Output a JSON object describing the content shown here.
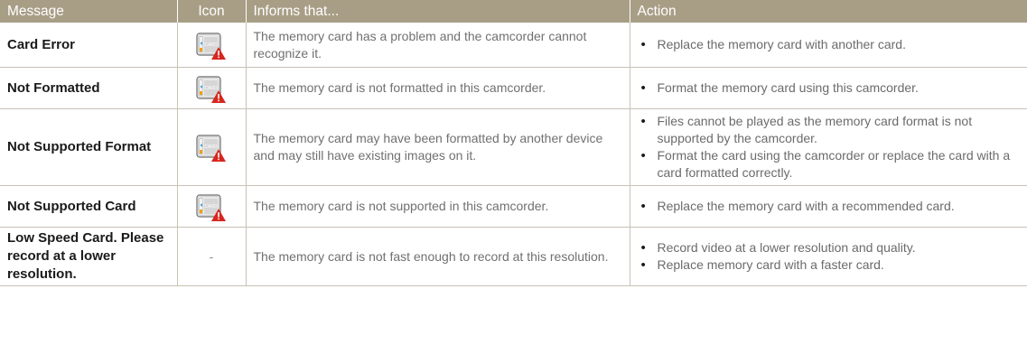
{
  "header": {
    "message": "Message",
    "icon": "Icon",
    "informs": "Informs that...",
    "action": "Action"
  },
  "rows": [
    {
      "message": "Card Error",
      "icon": "card-warning-icon",
      "card_text": "CARD",
      "informs": "The memory card has a problem and the camcorder cannot recognize it.",
      "actions": [
        "Replace the memory card with another card."
      ]
    },
    {
      "message": "Not Formatted",
      "icon": "card-warning-icon",
      "card_text": "CARD",
      "informs": "The memory card is not formatted in this camcorder.",
      "actions": [
        "Format the memory card using this camcorder."
      ]
    },
    {
      "message": "Not Supported Format",
      "icon": "card-warning-icon",
      "card_text": "CARD",
      "informs": "The memory card may have been formatted by another device and may still have existing images on it.",
      "actions": [
        "Files cannot be played as the memory card format is not supported by the camcorder.",
        "Format the card using the camcorder or replace the card with a card formatted correctly."
      ]
    },
    {
      "message": "Not Supported Card",
      "icon": "card-warning-icon",
      "card_text": "CARD",
      "informs": "The memory card is not supported in this camcorder.",
      "actions": [
        "Replace the memory card with a recommended card."
      ]
    },
    {
      "message": "Low Speed Card. Please record at a lower resolution.",
      "icon_text": "-",
      "informs": "The memory card is not fast enough to record at this resolution.",
      "actions": [
        "Record video at a lower resolution and quality.",
        "Replace memory card with a faster card."
      ]
    }
  ],
  "colors": {
    "header_bg": "#a89e86",
    "border": "#c8c2b4",
    "warning_red": "#d7261e",
    "card_blue": "#3aa0d8"
  }
}
